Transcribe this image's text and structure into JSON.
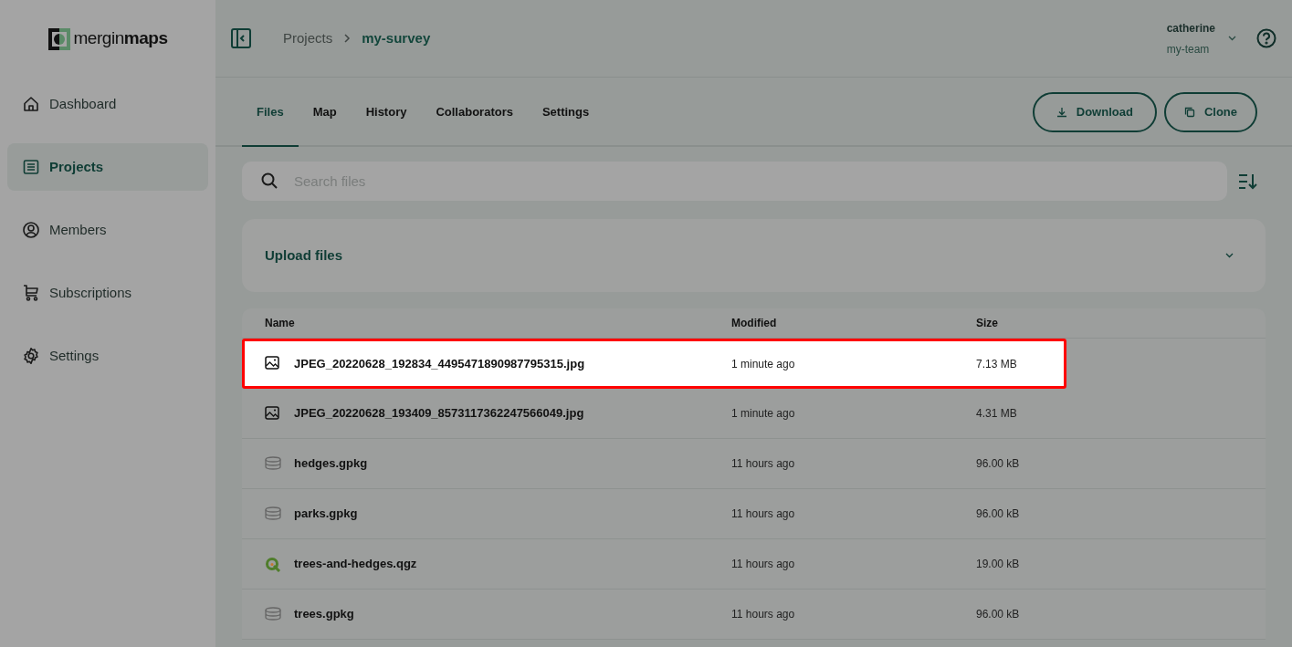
{
  "logo": {
    "prefix": "mergin",
    "suffix": "maps"
  },
  "sidebar": {
    "items": [
      {
        "label": "Dashboard",
        "kind": "home",
        "selected": false
      },
      {
        "label": "Projects",
        "kind": "list",
        "selected": true
      },
      {
        "label": "Members",
        "kind": "user",
        "selected": false
      },
      {
        "label": "Subscriptions",
        "kind": "cart",
        "selected": false
      },
      {
        "label": "Settings",
        "kind": "gear",
        "selected": false
      }
    ]
  },
  "breadcrumb": [
    "Projects",
    "my-survey"
  ],
  "user": {
    "name": "catherine",
    "team": "my-team"
  },
  "tabs": [
    {
      "label": "Files",
      "selected": true
    },
    {
      "label": "Map",
      "selected": false
    },
    {
      "label": "History",
      "selected": false
    },
    {
      "label": "Collaborators",
      "selected": false
    },
    {
      "label": "Settings",
      "selected": false
    }
  ],
  "buttons": [
    {
      "label": "Download",
      "kind": "download"
    },
    {
      "label": "Clone",
      "kind": "copy"
    }
  ],
  "search": {
    "placeholder": "Search files"
  },
  "upload": {
    "title": "Upload files"
  },
  "table": {
    "columns": [
      "Name",
      "Modified",
      "Size"
    ],
    "rows": [
      {
        "kind": "image",
        "name": "JPEG_20220628_192834_4495471890987795315.jpg",
        "modified": "1 minute ago",
        "size": "7.13 MB",
        "highlighted": true
      },
      {
        "kind": "image",
        "name": "JPEG_20220628_193409_8573117362247566049.jpg",
        "modified": "1 minute ago",
        "size": "4.31 MB",
        "highlighted": false
      },
      {
        "kind": "database",
        "name": "hedges.gpkg",
        "modified": "11 hours ago",
        "size": "96.00 kB",
        "highlighted": false
      },
      {
        "kind": "database",
        "name": "parks.gpkg",
        "modified": "11 hours ago",
        "size": "96.00 kB",
        "highlighted": false
      },
      {
        "kind": "qgis",
        "name": "trees-and-hedges.qgz",
        "modified": "11 hours ago",
        "size": "19.00 kB",
        "highlighted": false
      },
      {
        "kind": "database",
        "name": "trees.gpkg",
        "modified": "11 hours ago",
        "size": "96.00 kB",
        "highlighted": false
      }
    ]
  }
}
